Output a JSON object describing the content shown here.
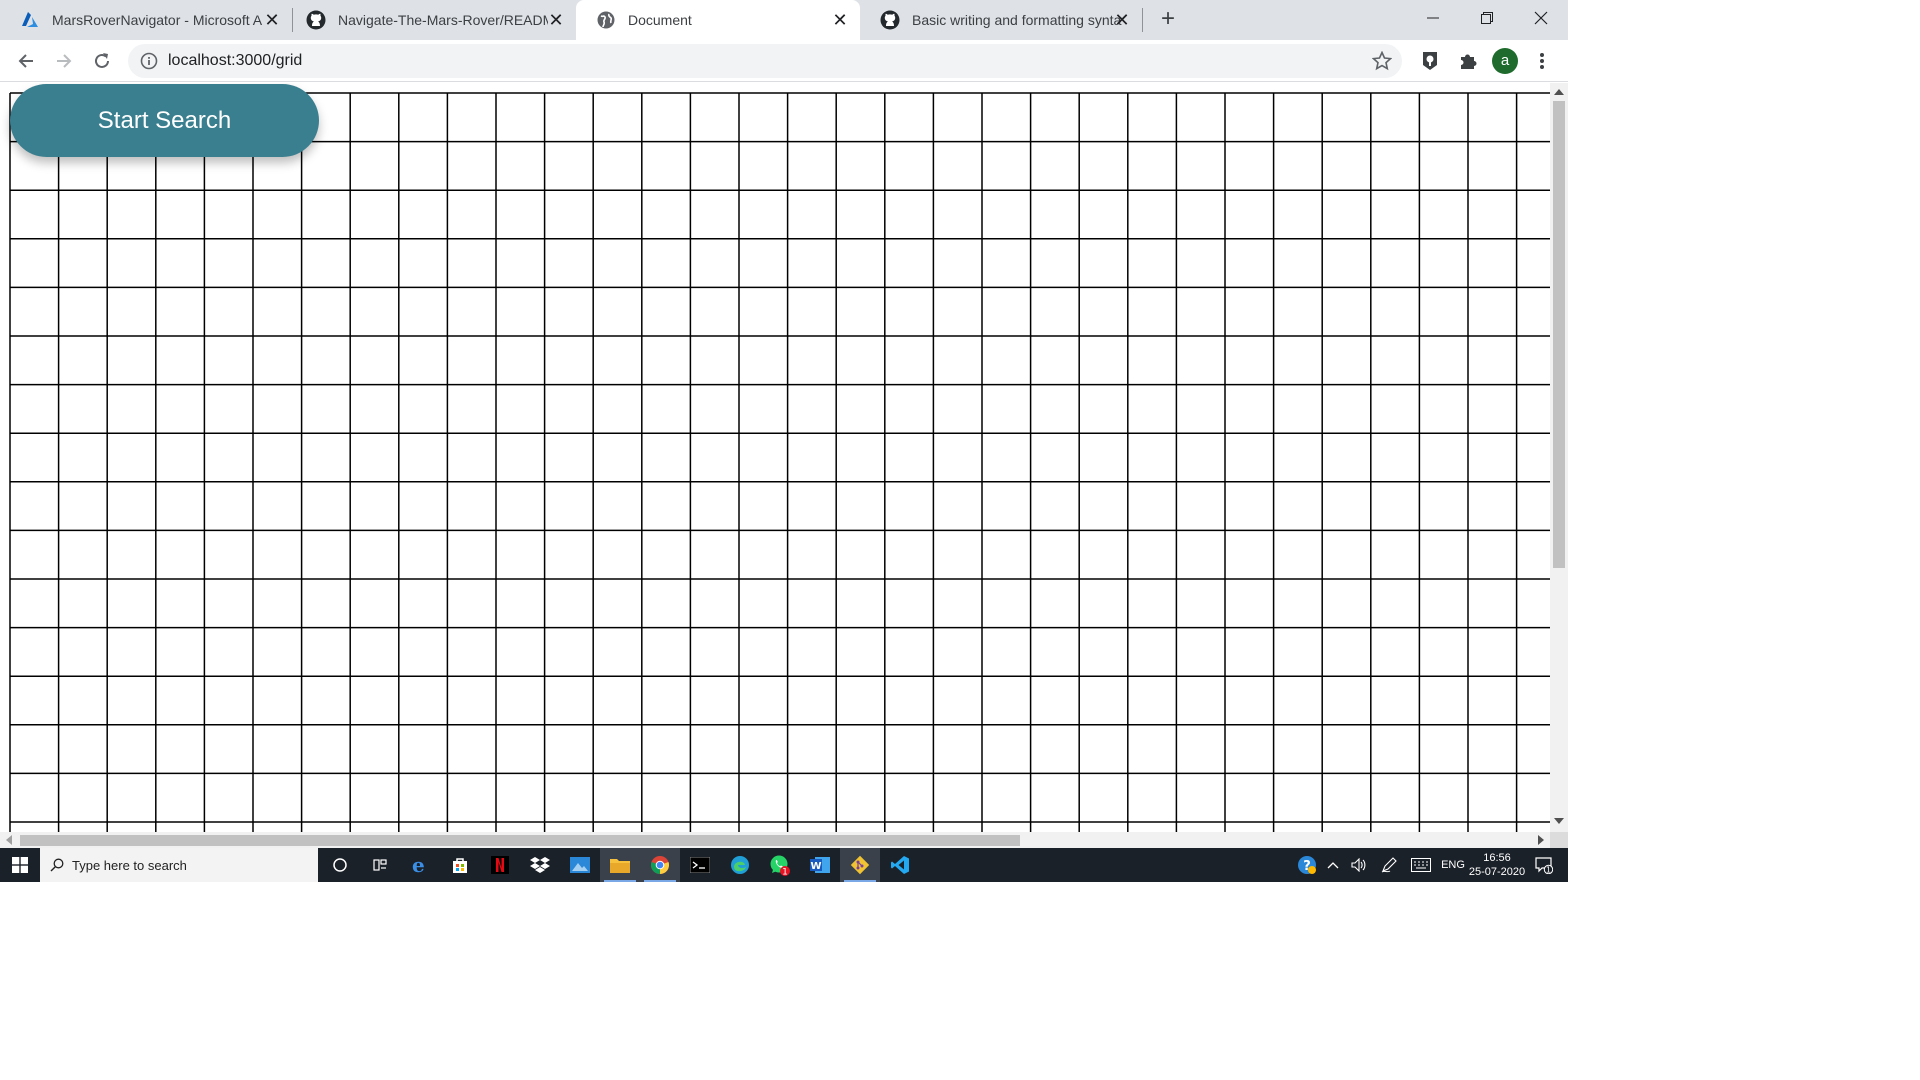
{
  "browser": {
    "tabs": [
      {
        "title": "MarsRoverNavigator - Microsoft Azure",
        "icon": "azure-icon",
        "active": false
      },
      {
        "title": "Navigate-The-Mars-Rover/README.md",
        "icon": "github-icon",
        "active": false
      },
      {
        "title": "Document",
        "icon": "globe-icon",
        "active": true
      },
      {
        "title": "Basic writing and formatting syntax",
        "icon": "github-icon",
        "active": false
      }
    ],
    "new_tab_label": "+",
    "address": "localhost:3000/grid",
    "profile_initial": "a"
  },
  "page": {
    "start_button_label": "Start Search",
    "grid": {
      "rows": 16,
      "cols": 32,
      "line_color": "#000000",
      "background": "#ffffff"
    },
    "accent_color": "#3a7f8f"
  },
  "taskbar": {
    "search_placeholder": "Type here to search",
    "apps": [
      "cortana-icon",
      "task-view-icon",
      "edge-icon",
      "store-icon",
      "netflix-icon",
      "dropbox-icon",
      "photos-icon",
      "file-explorer-icon",
      "chrome-icon",
      "terminal-icon",
      "edge-beta-icon",
      "whatsapp-icon",
      "word-icon",
      "git-icon",
      "vscode-icon"
    ],
    "whatsapp_badge": "1",
    "language": "ENG",
    "time": "16:56",
    "date": "25-07-2020",
    "notification_count": "1"
  }
}
